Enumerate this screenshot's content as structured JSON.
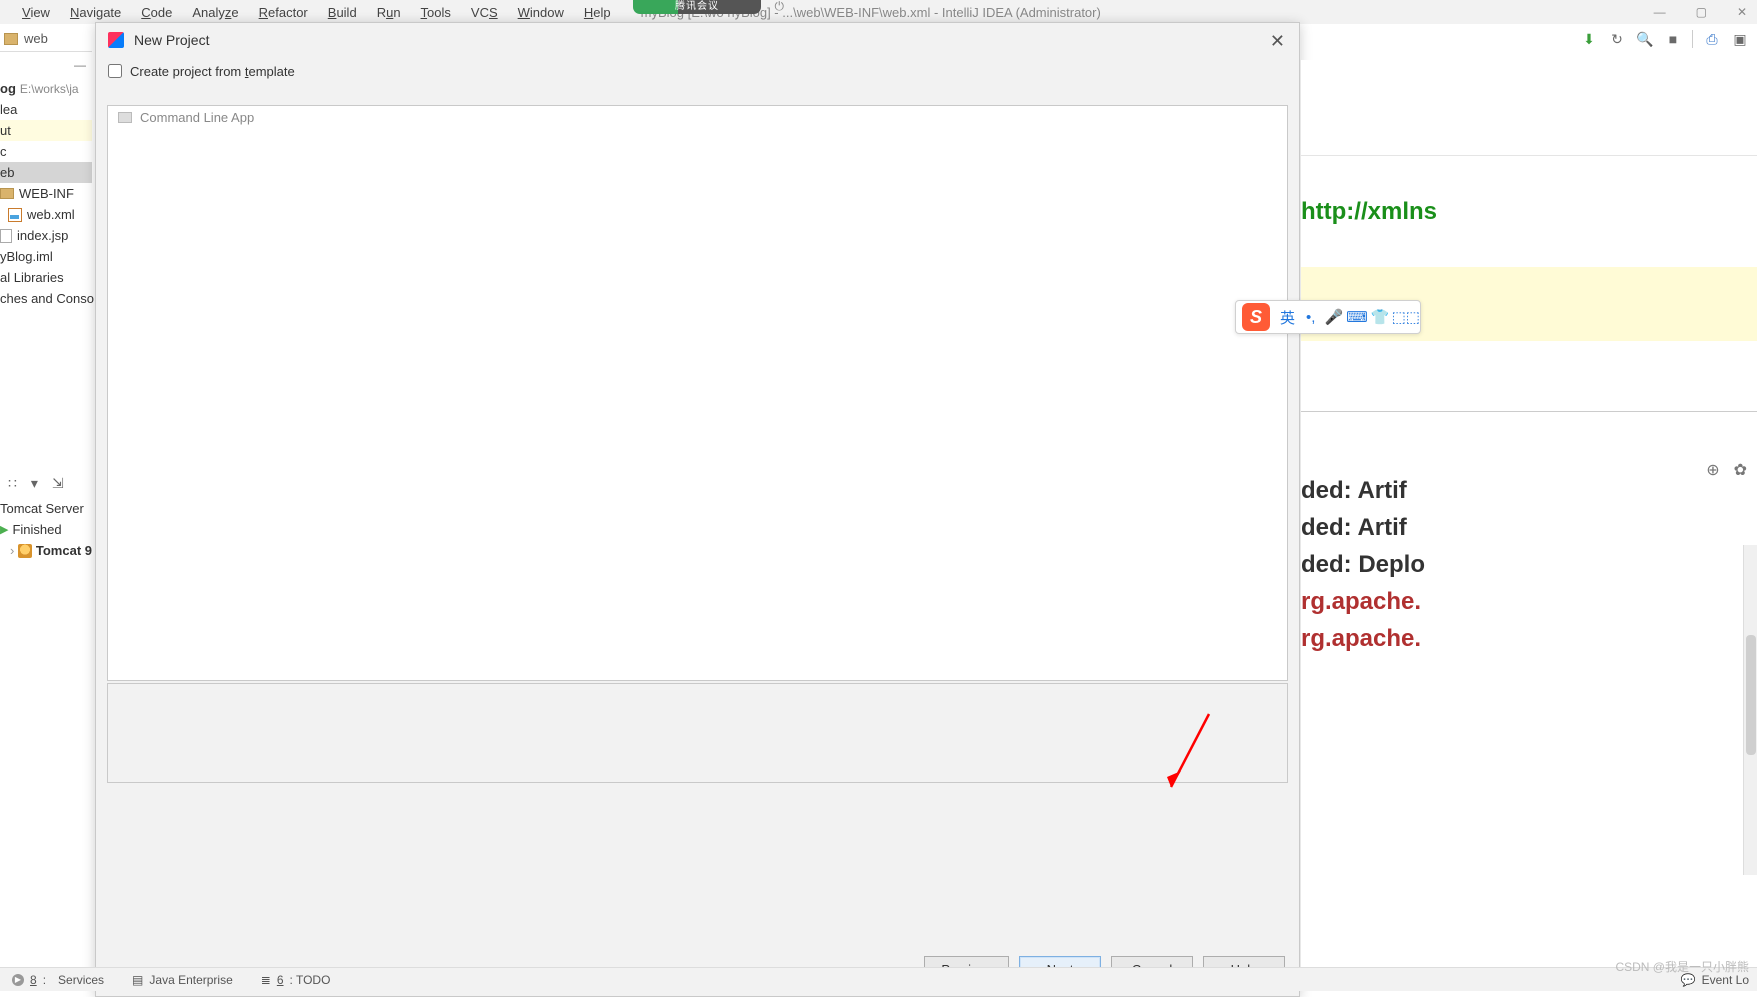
{
  "menu": {
    "items": [
      "View",
      "Navigate",
      "Code",
      "Analyze",
      "Refactor",
      "Build",
      "Run",
      "Tools",
      "VCS",
      "Window",
      "Help"
    ]
  },
  "window": {
    "title": "myBlog [E:\\wo                                        nyBlog] - ...\\web\\WEB-INF\\web.xml - IntelliJ IDEA (Administrator)",
    "controls": {
      "min": "—",
      "max": "▢",
      "close": "✕"
    }
  },
  "tencent_badge": "腾讯会议",
  "breadcrumb": {
    "label": "web"
  },
  "tree": {
    "root": {
      "name": "og",
      "path": "E:\\works\\ja"
    },
    "nodes": [
      "lea",
      "ut",
      "c",
      "eb",
      "WEB-INF",
      "web.xml",
      "index.jsp",
      "yBlog.iml",
      "al Libraries",
      "ches and Conso"
    ]
  },
  "services": {
    "toolbar_icons": [
      "∷",
      "▾",
      "✂",
      "⇲"
    ],
    "header": "Tomcat Server",
    "status": "Finished",
    "item": "Tomcat 9"
  },
  "statusbar": {
    "services": "8: Services",
    "java_ee": "Java Enterprise",
    "todo": "6: TODO",
    "eventlog": "Event Lo",
    "watermark": "CSDN @我是一只小胖熊"
  },
  "dialog": {
    "title": "New Project",
    "checkbox": "Create project from template",
    "list_item": "Command Line App",
    "buttons": {
      "prev": "Previous",
      "next": "Next",
      "cancel": "Cancel",
      "help": "Help"
    }
  },
  "editor": {
    "attr_text": "http://xmlns",
    "lines": [
      {
        "cls": "txt",
        "t": "ded: Artif"
      },
      {
        "cls": "txt",
        "t": "ded: Artif"
      },
      {
        "cls": "txt",
        "t": "ded: Deplo"
      },
      {
        "cls": "err",
        "t": "rg.apache."
      },
      {
        "cls": "err",
        "t": "rg.apache."
      }
    ],
    "toolbar_icons": [
      "⊕",
      "✿"
    ]
  },
  "ime": {
    "logo": "S",
    "cells": [
      "英",
      "•,",
      "🎤",
      "⌨",
      "👕",
      "⬚⬚"
    ]
  },
  "topright_icons": [
    "⬇",
    "↻",
    "🔍",
    "■",
    "",
    "⎙",
    "▣"
  ]
}
